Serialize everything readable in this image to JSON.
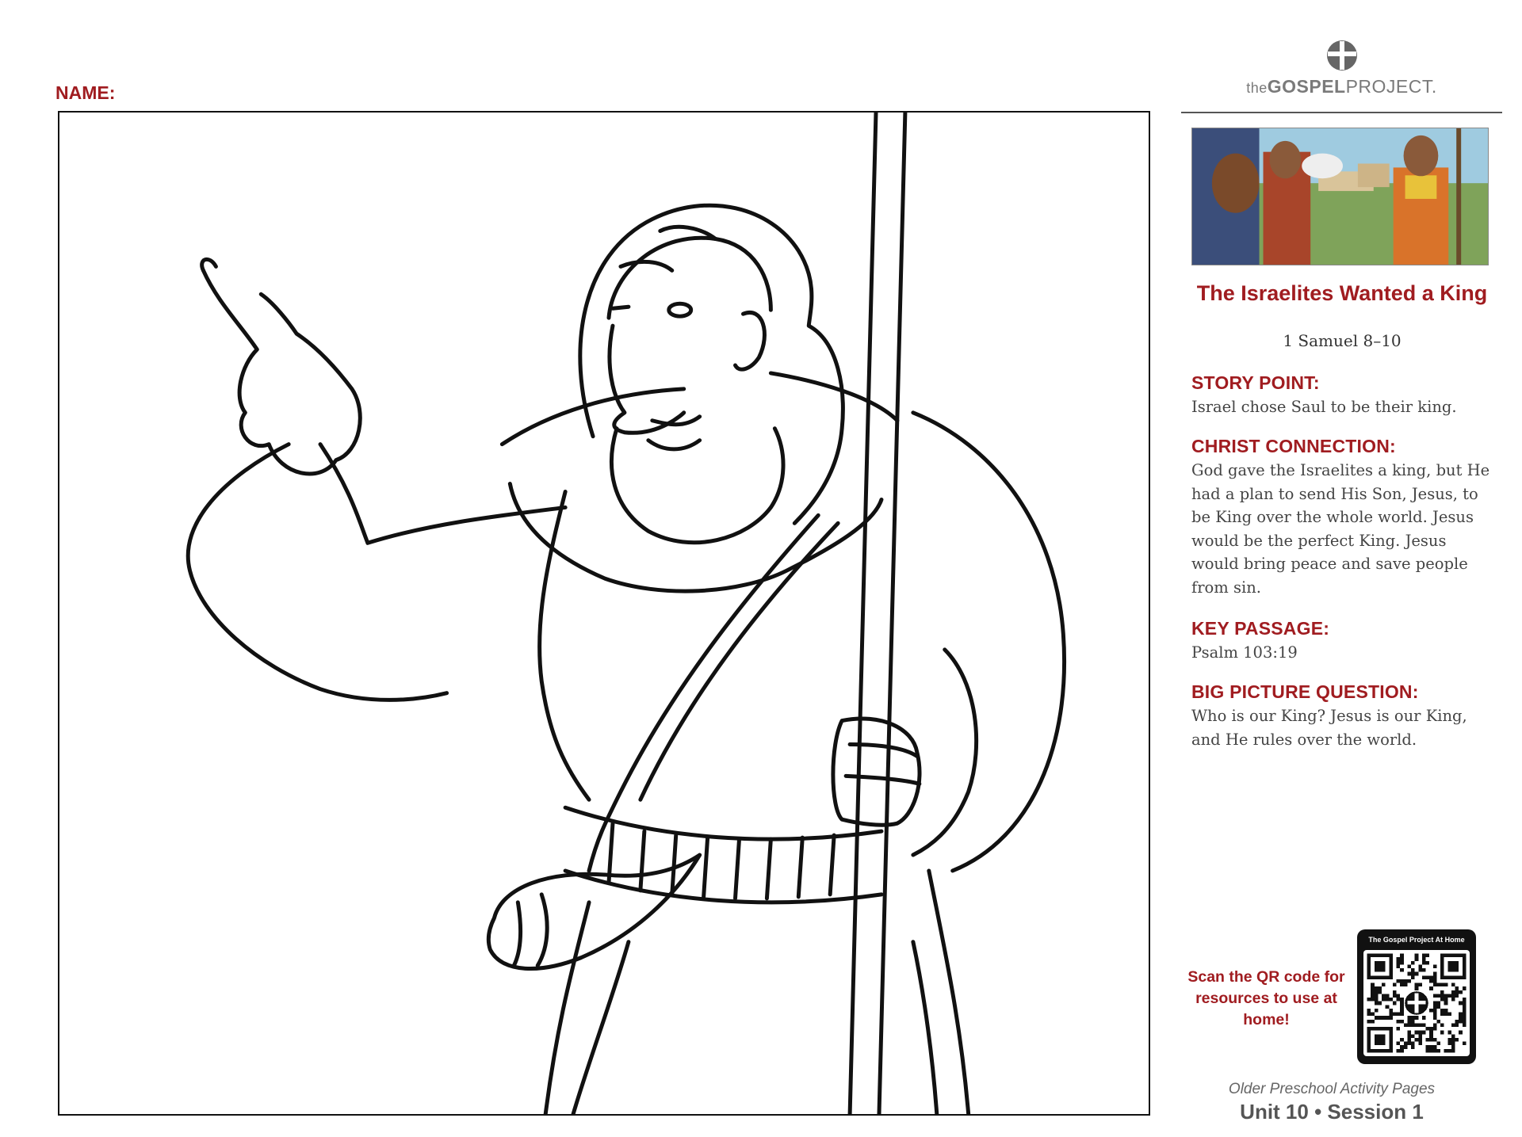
{
  "worksheet": {
    "name_label": "NAME:"
  },
  "brand": {
    "logo_the": "the",
    "logo_gospel": "GOSPEL",
    "logo_project": "PROJECT."
  },
  "lesson": {
    "title": "The Israelites Wanted a King",
    "reference": "1 Samuel 8–10"
  },
  "sections": [
    {
      "heading": "STORY POINT:",
      "body": "Israel chose Saul to be their king."
    },
    {
      "heading": "CHRIST CONNECTION:",
      "body": "God gave the Israelites a king, but He had a plan to send His Son, Jesus, to be King over the whole world. Jesus would be the perfect King. Jesus would bring peace and save people from sin."
    },
    {
      "heading": "KEY PASSAGE:",
      "body": "Psalm 103:19"
    },
    {
      "heading": "BIG PICTURE QUESTION:",
      "body": "Who is our King? Jesus is our King, and He rules over the world."
    }
  ],
  "qr": {
    "cta": "Scan the QR code for resources to use at home!",
    "card_title": "The Gospel Project At Home"
  },
  "footer": {
    "subtitle": "Older Preschool Activity Pages",
    "unit_session": "Unit 10 • Session 1"
  },
  "colors": {
    "accent_red": "#a01c20",
    "body_text": "#444444"
  }
}
